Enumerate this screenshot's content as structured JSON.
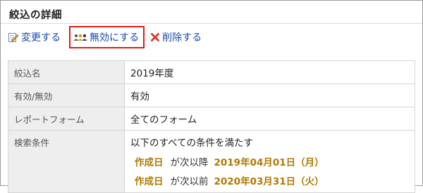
{
  "page": {
    "title": "絞込の詳細"
  },
  "toolbar": {
    "edit_label": "変更する",
    "disable_label": "無効にする",
    "delete_label": "削除する",
    "edit_icon": "edit-icon",
    "disable_icon": "disable-icon",
    "delete_icon": "delete-icon"
  },
  "details": {
    "name": {
      "label": "絞込名",
      "value": "2019年度"
    },
    "status": {
      "label": "有効/無効",
      "value": "有効",
      "color": "#1a8a1a"
    },
    "report_form": {
      "label": "レポートフォーム",
      "value": "全てのフォーム"
    },
    "conditions": {
      "label": "検索条件",
      "intro": "以下のすべての条件を満たす",
      "items": [
        {
          "field": "作成日",
          "operator": "が次以降",
          "value": "2019年04月01日（月）"
        },
        {
          "field": "作成日",
          "operator": "が次以前",
          "value": "2020年03月31日（火）"
        }
      ],
      "highlight_color": "#b07a00"
    }
  },
  "colors": {
    "link": "#1a4ba8",
    "focus_border": "#e21a1a",
    "label_bg": "#eeeeee"
  }
}
